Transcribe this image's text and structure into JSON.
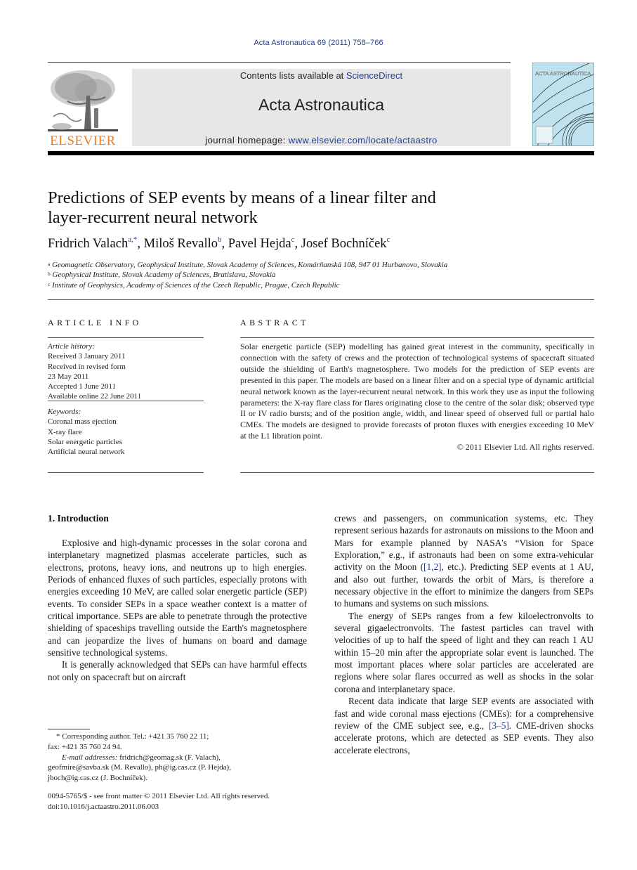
{
  "header": {
    "citation": "Acta Astronautica 69 (2011) 758–766",
    "contents_prefix": "Contents lists available at ",
    "contents_link": "ScienceDirect",
    "journal_name": "Acta Astronautica",
    "homepage_prefix": "journal homepage: ",
    "homepage_link": "www.elsevier.com/locate/actaastro",
    "publisher_logo_text": "ELSEVIER",
    "cover_title": "ACTA ASTRONAUTICA",
    "brand_color": "#f07c1a",
    "link_color": "#1f3f95"
  },
  "article": {
    "title_line1": "Predictions of SEP events by means of a linear filter and",
    "title_line2": "layer-recurrent neural network",
    "authors": [
      {
        "name": "Fridrich Valach",
        "sup": "a,*"
      },
      {
        "name": "Miloš Revallo",
        "sup": "b"
      },
      {
        "name": "Pavel Hejda",
        "sup": "c"
      },
      {
        "name": "Josef Bochníček",
        "sup": "c"
      }
    ],
    "separator": ", ",
    "affiliations": [
      {
        "mark": "a",
        "text": "Geomagnetic Observatory, Geophysical Institute, Slovak Academy of Sciences, Komárňanská 108, 947 01 Hurbanovo, Slovakia"
      },
      {
        "mark": "b",
        "text": "Geophysical Institute, Slovak Academy of Sciences, Bratislava, Slovakia"
      },
      {
        "mark": "c",
        "text": "Institute of Geophysics, Academy of Sciences of the Czech Republic, Prague, Czech Republic"
      }
    ]
  },
  "article_info": {
    "heading": "ARTICLE INFO",
    "history_label": "Article history:",
    "history": [
      "Received 3 January 2011",
      "Received in revised form",
      "23 May 2011",
      "Accepted 1 June 2011",
      "Available online 22 June 2011"
    ],
    "keywords_label": "Keywords:",
    "keywords": [
      "Coronal mass ejection",
      "X-ray flare",
      "Solar energetic particles",
      "Artificial neural network"
    ]
  },
  "abstract": {
    "heading": "ABSTRACT",
    "text": "Solar energetic particle (SEP) modelling has gained great interest in the community, specifically in connection with the safety of crews and the protection of technological systems of spacecraft situated outside the shielding of Earth's magnetosphere. Two models for the prediction of SEP events are presented in this paper. The models are based on a linear filter and on a special type of dynamic artificial neural network known as the layer-recurrent neural network. In this work they use as input the following parameters: the X-ray flare class for flares originating close to the centre of the solar disk; observed type II or IV radio bursts; and of the position angle, width, and linear speed of observed full or partial halo CMEs. The models are designed to provide forecasts of proton fluxes with energies exceeding 10 MeV at the L1 libration point.",
    "copyright": "© 2011 Elsevier Ltd. All rights reserved."
  },
  "body": {
    "section_heading": "1.  Introduction",
    "left_p1": "Explosive and high-dynamic processes in the solar corona and interplanetary magnetized plasmas accelerate particles, such as electrons, protons, heavy ions, and neutrons up to high energies. Periods of enhanced fluxes of such particles, especially protons with energies exceeding 10 MeV, are called solar energetic particle (SEP) events. To consider SEPs in a space weather context is a matter of critical importance. SEPs are able to penetrate through the protective shielding of spaceships travelling outside the Earth's magnetosphere and can jeopardize the lives of humans on board and damage sensitive technological systems.",
    "left_p2": "It is generally acknowledged that SEPs can have harmful effects not only on spacecraft but on aircraft",
    "right_p1_a": "crews and passengers, on communication systems, etc. They represent serious hazards for astronauts on missions to the Moon and Mars for example planned by NASA's “Vision for Space Exploration,” e.g., if astronauts had been on some extra-vehicular activity on the Moon (",
    "right_p1_ref": "[1,2]",
    "right_p1_b": ", etc.). Predicting SEP events at 1 AU, and also out further, towards the orbit of Mars, is therefore a necessary objective in the effort to minimize the dangers from SEPs to humans and systems on such missions.",
    "right_p2": "The energy of SEPs ranges from a few kiloelectronvolts to several gigaelectronvolts. The fastest particles can travel with velocities of up to half the speed of light and they can reach 1 AU within 15–20 min after the appropriate solar event is launched. The most important places where solar particles are accelerated are regions where solar flares occurred as well as shocks in the solar corona and interplanetary space.",
    "right_p3_a": "Recent data indicate that large SEP events are associated with fast and wide coronal mass ejections (CMEs): for a comprehensive review of the CME subject see, e.g., ",
    "right_p3_ref": "[3–5]",
    "right_p3_b": ". CME-driven shocks accelerate protons, which are detected as SEP events. They also accelerate electrons,"
  },
  "footnotes": {
    "corresponding": "* Corresponding author. Tel.: +421 35 760 22 11;",
    "fax": "fax: +421 35 760 24 94.",
    "email_label": "E-mail addresses:",
    "email_line1": " fridrich@geomag.sk (F. Valach),",
    "email_line2": "geofmire@savba.sk (M. Revallo), ph@ig.cas.cz (P. Hejda),",
    "email_line3": "jboch@ig.cas.cz (J. Bochníček).",
    "issn": "0094-5765/$ - see front matter © 2011 Elsevier Ltd. All rights reserved.",
    "doi": "doi:10.1016/j.actaastro.2011.06.003"
  }
}
